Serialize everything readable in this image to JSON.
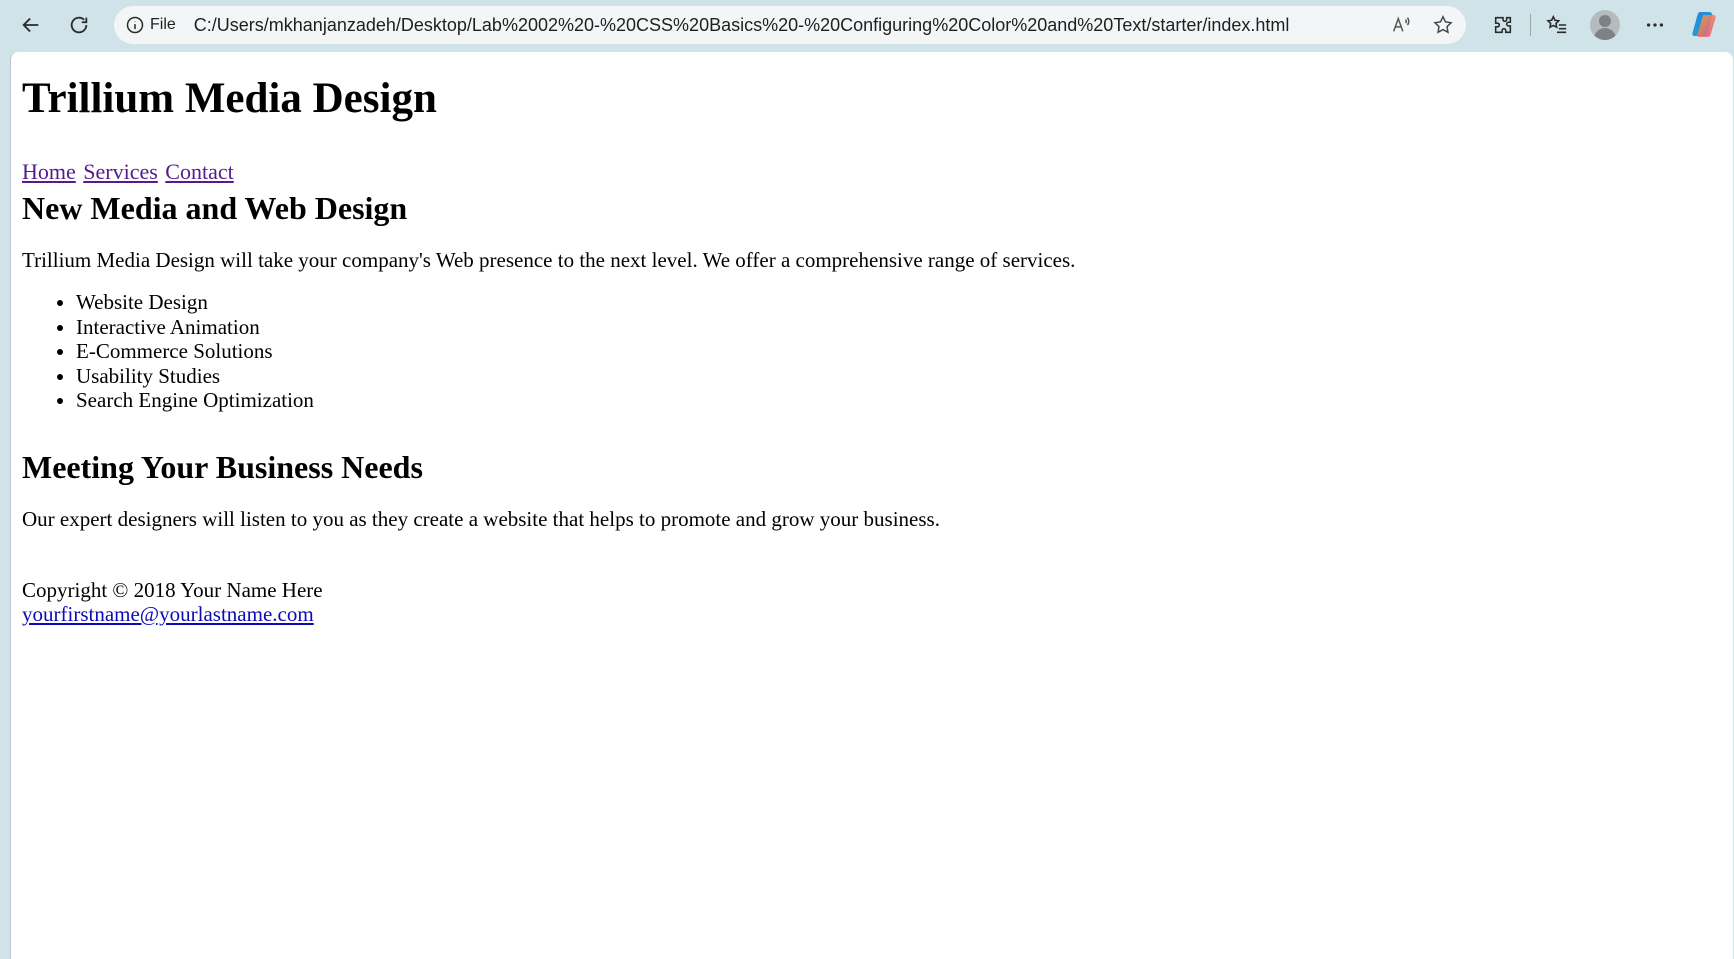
{
  "browser": {
    "address_label": "File",
    "url": "C:/Users/mkhanjanzadeh/Desktop/Lab%2002%20-%20CSS%20Basics%20-%20Configuring%20Color%20and%20Text/starter/index.html",
    "icons": [
      "back-icon",
      "refresh-icon",
      "info-icon",
      "read-aloud-icon",
      "favorite-star-icon",
      "extensions-icon",
      "favorites-icon",
      "profile-avatar",
      "more-icon",
      "copilot-icon"
    ]
  },
  "page": {
    "title": "Trillium Media Design",
    "nav": [
      "Home",
      "Services",
      "Contact"
    ],
    "section1": {
      "heading": "New Media and Web Design",
      "text": "Trillium Media Design will take your company's Web presence to the next level. We offer a comprehensive range of services.",
      "services": [
        "Website Design",
        "Interactive Animation",
        "E-Commerce Solutions",
        "Usability Studies",
        "Search Engine Optimization"
      ]
    },
    "section2": {
      "heading": "Meeting Your Business Needs",
      "text": "Our expert designers will listen to you as they create a website that helps to promote and grow your business."
    },
    "footer": {
      "copyright": "Copyright © 2018 Your Name Here",
      "email": "yourfirstname@yourlastname.com"
    }
  },
  "colors": {
    "chrome": "#cfe3e8",
    "visited_link": "#551a8b",
    "link": "#0b0bb8"
  }
}
